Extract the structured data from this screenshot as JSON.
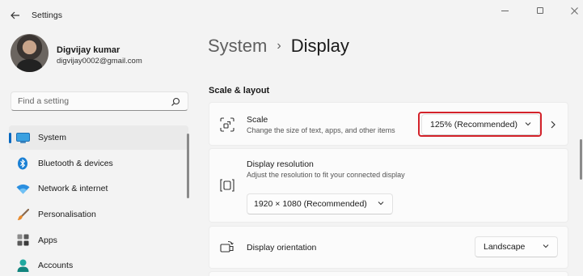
{
  "window": {
    "title": "Settings"
  },
  "user": {
    "name": "Digvijay kumar",
    "email": "digvijay0002@gmail.com"
  },
  "search": {
    "placeholder": "Find a setting"
  },
  "sidebar": {
    "items": [
      {
        "label": "System",
        "icon": "monitor-icon",
        "active": true
      },
      {
        "label": "Bluetooth & devices",
        "icon": "bluetooth-icon"
      },
      {
        "label": "Network & internet",
        "icon": "wifi-icon"
      },
      {
        "label": "Personalisation",
        "icon": "paintbrush-icon"
      },
      {
        "label": "Apps",
        "icon": "apps-icon"
      },
      {
        "label": "Accounts",
        "icon": "person-icon"
      }
    ]
  },
  "breadcrumb": {
    "parent": "System",
    "separator": "›",
    "current": "Display"
  },
  "section": {
    "title": "Scale & layout"
  },
  "settings": {
    "scale": {
      "title": "Scale",
      "description": "Change the size of text, apps, and other items",
      "value": "125% (Recommended)"
    },
    "resolution": {
      "title": "Display resolution",
      "description": "Adjust the resolution to fit your connected display",
      "value": "1920 × 1080 (Recommended)"
    },
    "orientation": {
      "title": "Display orientation",
      "value": "Landscape"
    }
  },
  "colors": {
    "accent": "#0067c0",
    "highlight": "#d3222a",
    "background": "#f3f3f3",
    "card": "#fbfbfb"
  }
}
